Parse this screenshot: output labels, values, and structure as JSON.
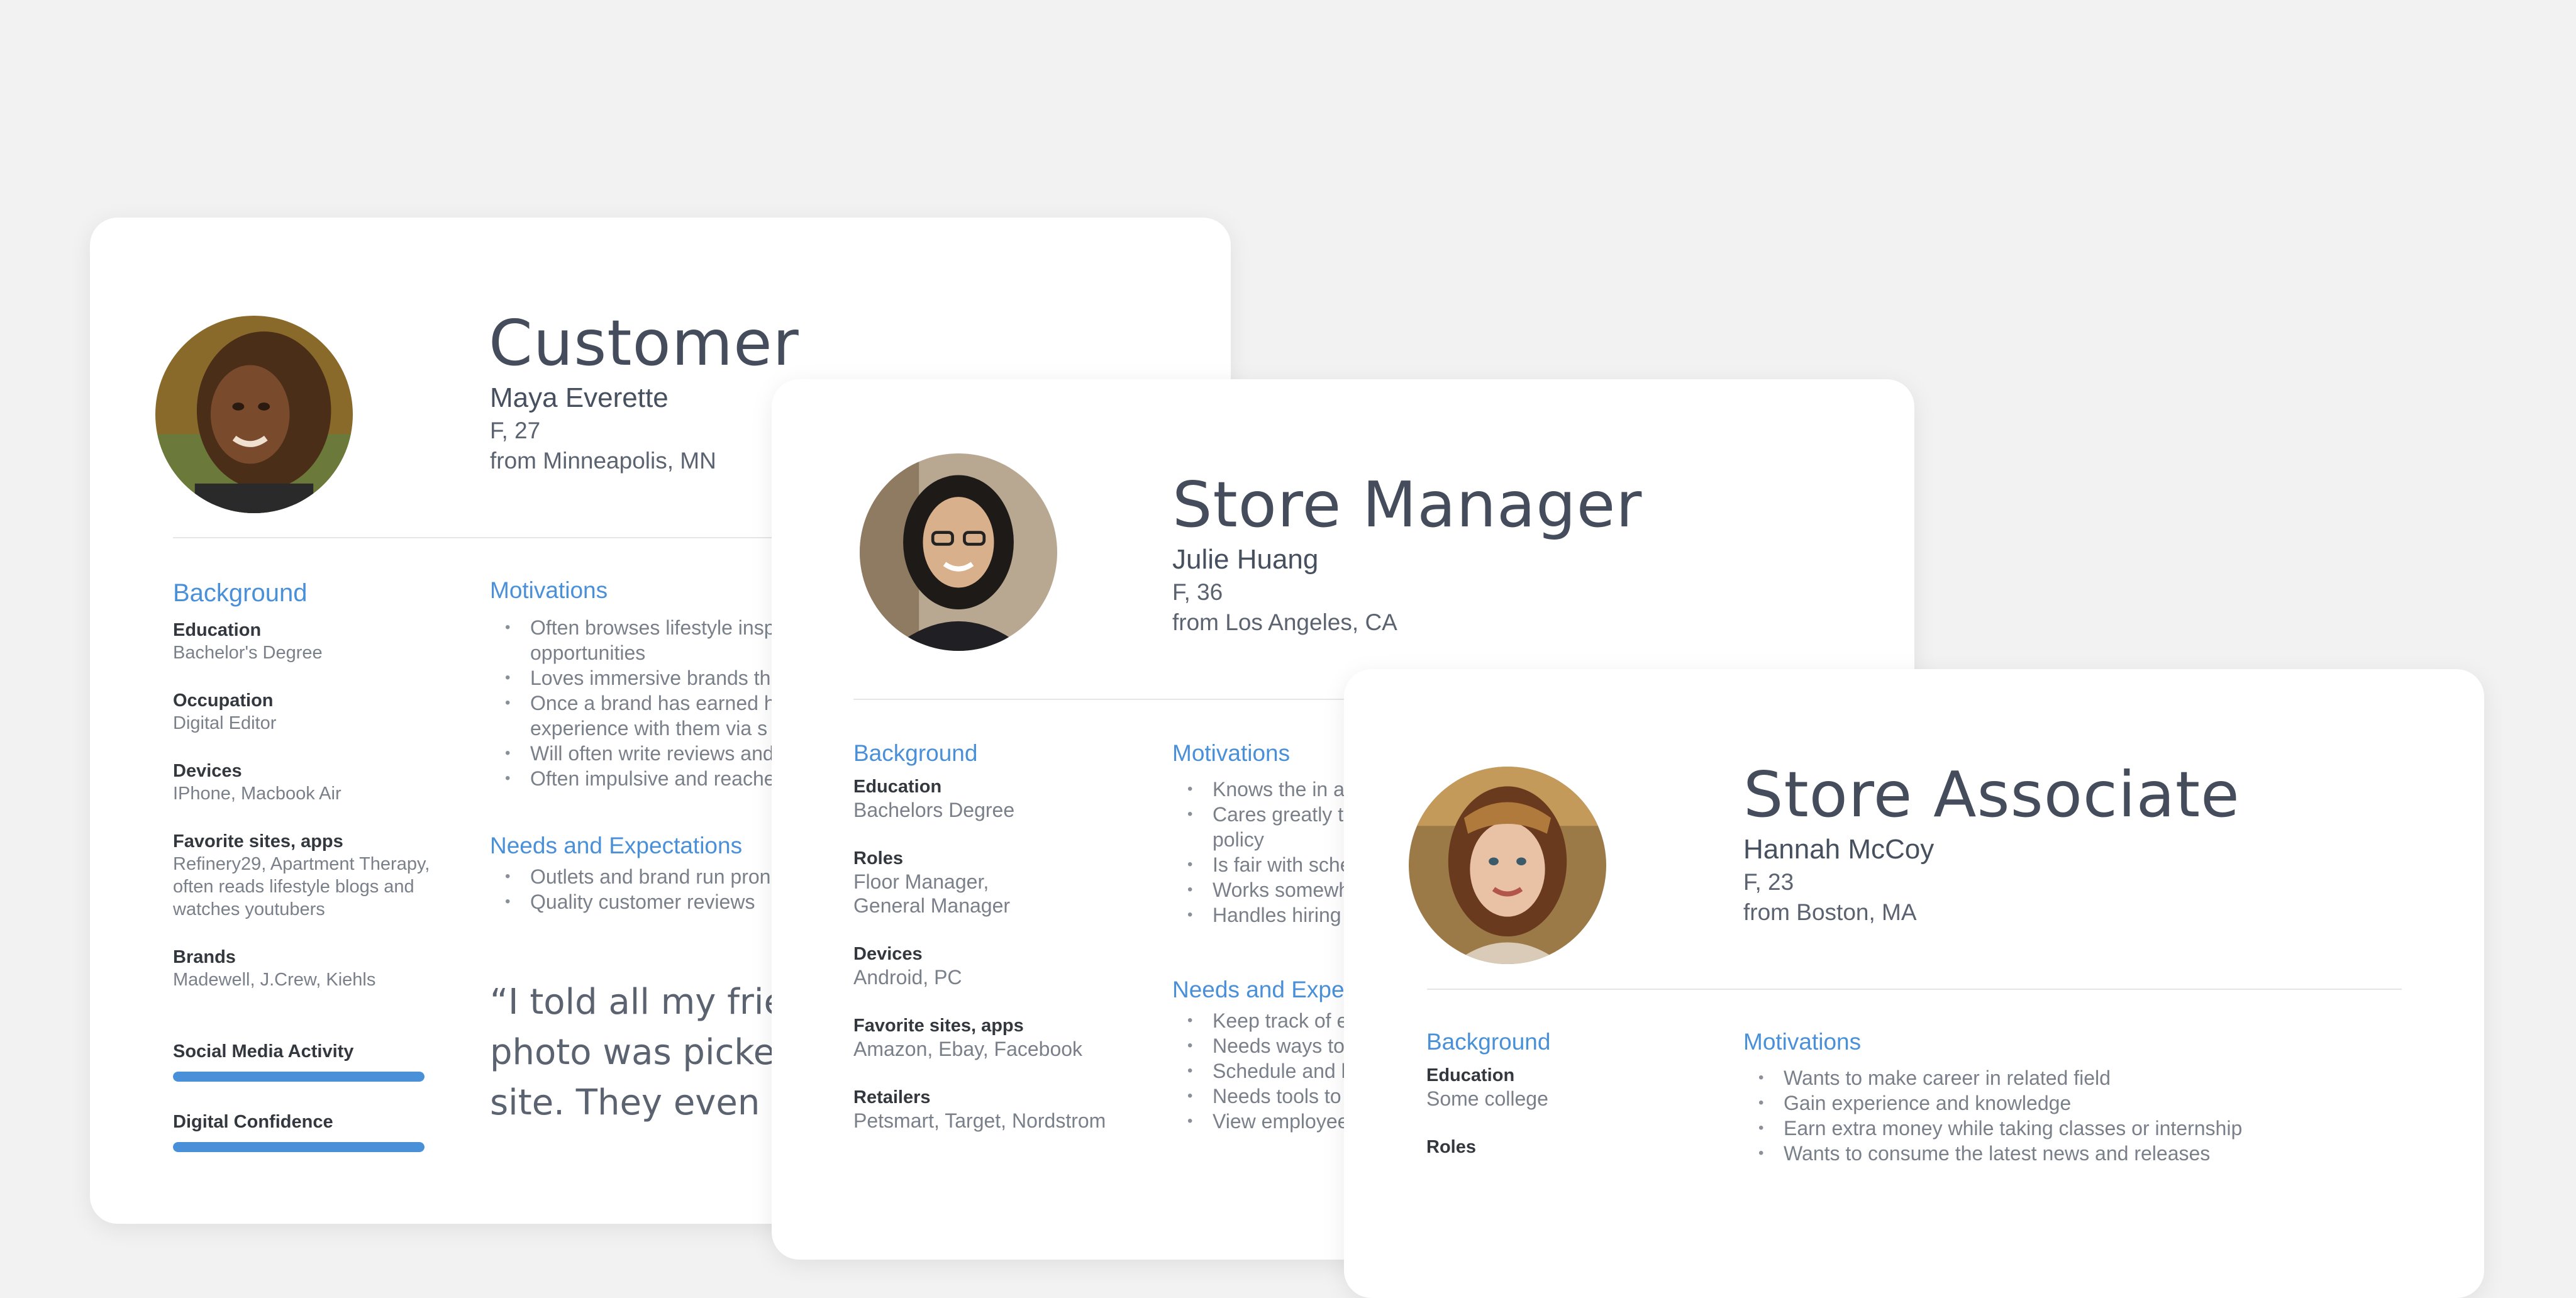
{
  "colors": {
    "accent": "#4a90d9",
    "bar": "#4a90d9"
  },
  "customer": {
    "role": "Customer",
    "name": "Maya Everette",
    "demographic": "F, 27",
    "location": "from Minneapolis, MN",
    "background_title": "Background",
    "background": [
      {
        "label": "Education",
        "value": "Bachelor's Degree"
      },
      {
        "label": "Occupation",
        "value": "Digital Editor"
      },
      {
        "label": "Devices",
        "value": "IPhone, Macbook Air"
      },
      {
        "label": "Favorite sites, apps",
        "value": "Refinery29, Apartment Therapy, often reads lifestyle blogs and watches youtubers"
      },
      {
        "label": "Brands",
        "value": "Madewell, J.Crew, Kiehls"
      }
    ],
    "meters": [
      {
        "label": "Social Media Activity",
        "level": 1.0
      },
      {
        "label": "Digital Confidence",
        "level": 1.0
      }
    ],
    "motivations_title": "Motivations",
    "motivations": [
      "Often browses lifestyle insp",
      "opportunities",
      "Loves immersive brands th",
      "Once a brand has earned h",
      "experience with them via s",
      "Will often write reviews and",
      "Often impulsive and reache"
    ],
    "needs_title": "Needs and Expectations",
    "needs": [
      "Outlets and brand run pron",
      "Quality customer reviews"
    ],
    "quote_lines": [
      "“I told all my friend",
      "photo was picked t",
      "site. They even gav"
    ]
  },
  "manager": {
    "role": "Store Manager",
    "name": "Julie Huang",
    "demographic": "F, 36",
    "location": "from Los Angeles, CA",
    "background_title": "Background",
    "background": [
      {
        "label": "Education",
        "value": "Bachelors Degree"
      },
      {
        "label": "Roles",
        "value": "Floor Manager, General Manager"
      },
      {
        "label": "Devices",
        "value": "Android, PC"
      },
      {
        "label": "Favorite sites, apps",
        "value": "Amazon, Ebay, Facebook"
      },
      {
        "label": "Retailers",
        "value": "Petsmart, Target, Nordstrom"
      }
    ],
    "motivations_title": "Motivations",
    "motivations": [
      "Knows the in a",
      "Cares greatly t",
      "policy",
      "Is fair with sche",
      "Works somewh",
      "Handles hiring"
    ],
    "needs_title": "Needs and Expe",
    "needs": [
      "Keep track of e",
      "Needs ways to",
      "Schedule and l",
      "Needs tools to",
      "View employee"
    ]
  },
  "associate": {
    "role": "Store Associate",
    "name": "Hannah McCoy",
    "demographic": "F, 23",
    "location": "from Boston, MA",
    "background_title": "Background",
    "background": [
      {
        "label": "Education",
        "value": "Some college"
      },
      {
        "label": "Roles",
        "value": ""
      }
    ],
    "motivations_title": "Motivations",
    "motivations": [
      "Wants to make career in related field",
      "Gain experience and knowledge",
      "Earn extra money while taking classes or internship",
      "Wants to consume the latest news and releases"
    ]
  }
}
